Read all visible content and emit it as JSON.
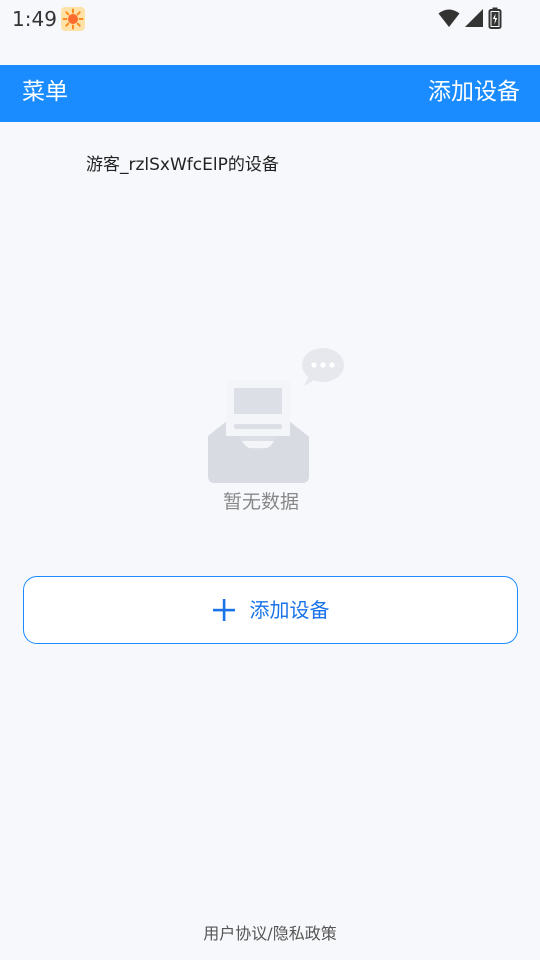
{
  "status_bar": {
    "time": "1:49",
    "notification_icon": "weather-sun-icon",
    "wifi_icon": "wifi-icon",
    "signal_icon": "cellular-signal-icon",
    "battery_icon": "battery-charging-icon"
  },
  "topbar": {
    "menu_label": "菜单",
    "add_device_label": "添加设备",
    "background_color": "#1a8cff"
  },
  "device_owner": "游客_rzlSxWfcElP的设备",
  "empty_state": {
    "icon": "empty-inbox-icon",
    "text": "暂无数据"
  },
  "add_button": {
    "icon": "plus-icon",
    "label": "添加设备",
    "accent_color": "#1a73e8"
  },
  "footer": {
    "link": "用户协议/隐私政策"
  }
}
